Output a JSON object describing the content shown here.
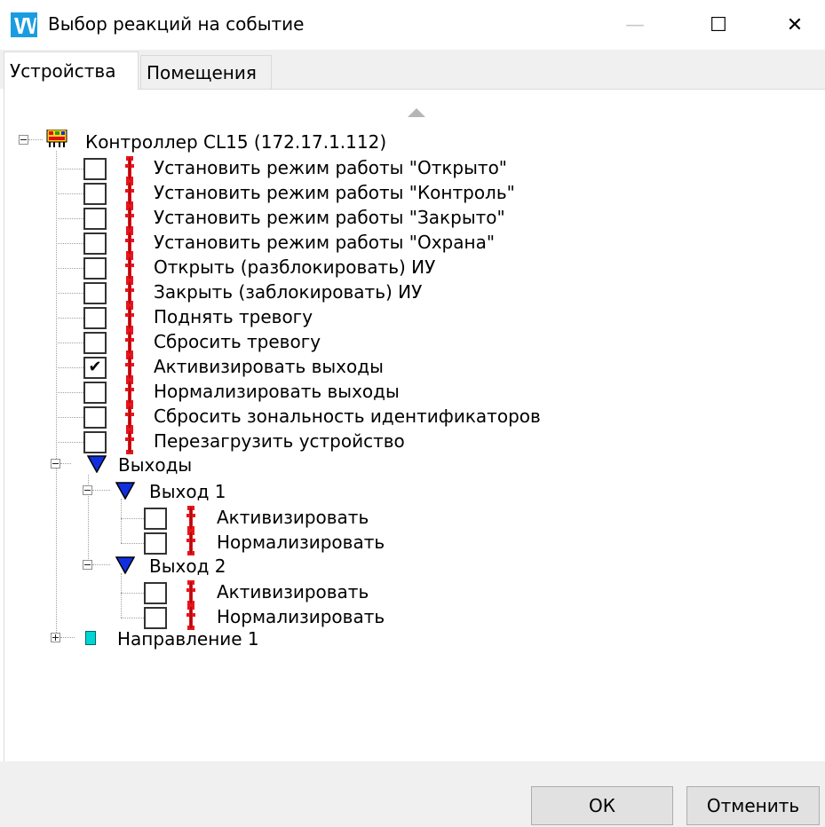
{
  "window": {
    "title": "Выбор реакций на событие",
    "minimize_glyph": "—",
    "maximize_glyph": "☐",
    "close_glyph": "✕"
  },
  "tabs": [
    {
      "label": "Устройства",
      "active": true
    },
    {
      "label": "Помещения",
      "active": false
    }
  ],
  "tree": {
    "controller": {
      "label": "Контроллер CL15 (172.17.1.112)",
      "icon": "controller-icon",
      "actions": [
        {
          "label": "Установить режим работы \"Открыто\"",
          "checked": false
        },
        {
          "label": "Установить режим работы \"Контроль\"",
          "checked": false
        },
        {
          "label": "Установить режим работы \"Закрыто\"",
          "checked": false
        },
        {
          "label": "Установить режим работы \"Охрана\"",
          "checked": false
        },
        {
          "label": "Открыть (разблокировать) ИУ",
          "checked": false
        },
        {
          "label": "Закрыть (заблокировать) ИУ",
          "checked": false
        },
        {
          "label": "Поднять тревогу",
          "checked": false
        },
        {
          "label": "Сбросить тревогу",
          "checked": false
        },
        {
          "label": "Активизировать выходы",
          "checked": true
        },
        {
          "label": "Нормализировать выходы",
          "checked": false
        },
        {
          "label": "Сбросить зональность идентификаторов",
          "checked": false
        },
        {
          "label": "Перезагрузить устройство",
          "checked": false
        }
      ]
    },
    "outputs": {
      "label": "Выходы",
      "icon": "blue-triangle-icon",
      "items": [
        {
          "label": "Выход 1",
          "actions": [
            {
              "label": "Активизировать",
              "checked": false
            },
            {
              "label": "Нормализировать",
              "checked": false
            }
          ]
        },
        {
          "label": "Выход 2",
          "actions": [
            {
              "label": "Активизировать",
              "checked": false
            },
            {
              "label": "Нормализировать",
              "checked": false
            }
          ]
        }
      ]
    },
    "direction": {
      "label": "Направление 1",
      "icon": "direction-icon"
    }
  },
  "check_glyph": "✔",
  "buttons": {
    "ok": "ОК",
    "cancel": "Отменить"
  },
  "colors": {
    "action_icon": "#e8141c",
    "output_icon": "#1030e0",
    "direction_icon": "#00d4d4"
  }
}
